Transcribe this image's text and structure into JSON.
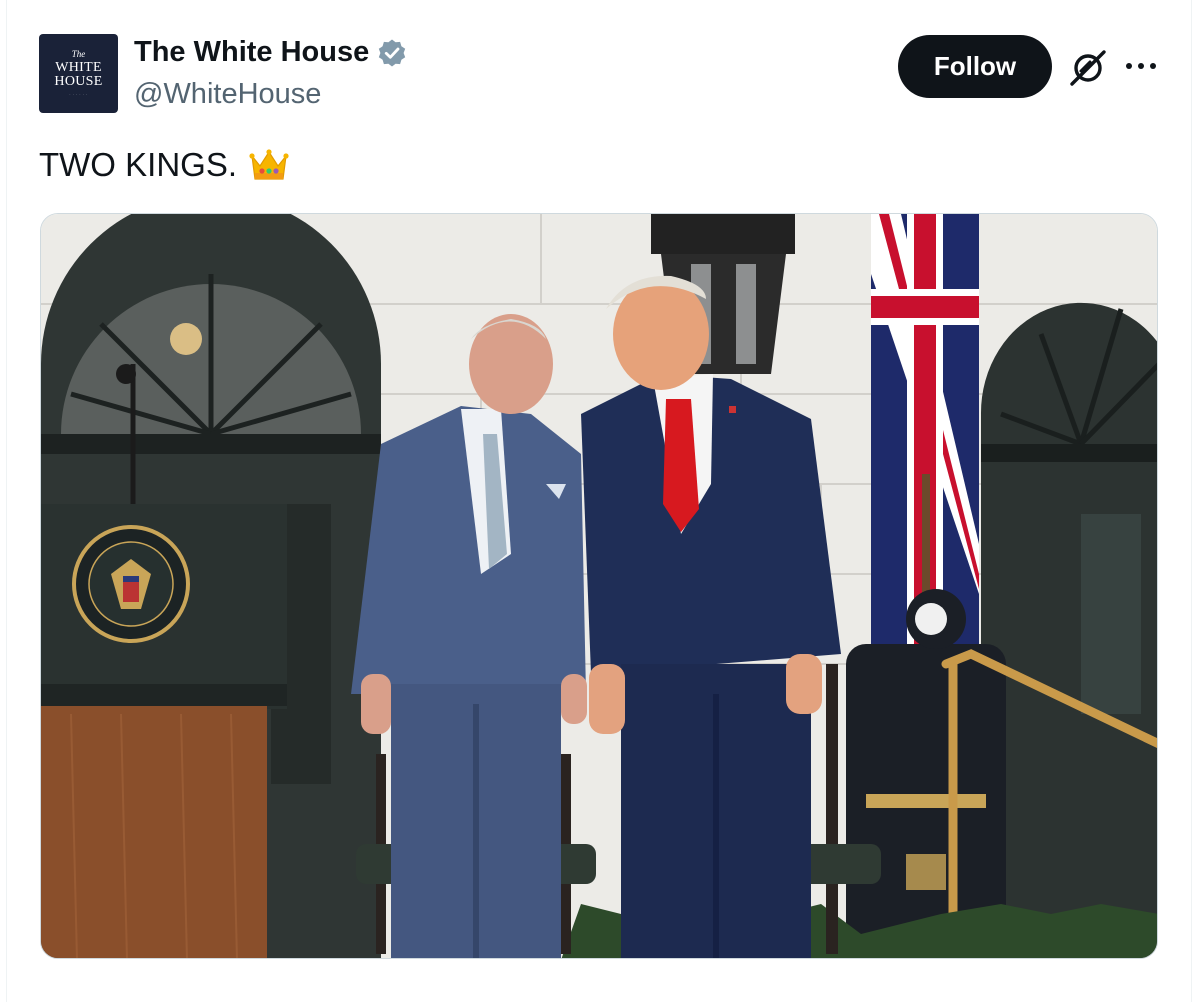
{
  "tweet": {
    "author": {
      "name": "The White House",
      "handle": "@WhiteHouse",
      "verified": true,
      "avatar_lines": [
        "The",
        "WHITE",
        "HOUSE"
      ]
    },
    "follow_label": "Follow",
    "text": "TWO KINGS.",
    "emoji": "crown-emoji",
    "media": {
      "type": "photo"
    }
  },
  "icons": {
    "verified": "verified-badge-icon",
    "grok": "grok-icon",
    "more": "more-icon"
  },
  "colors": {
    "text_primary": "#0f1419",
    "text_secondary": "#536471",
    "follow_bg": "#0f1419",
    "verified_badge": "#829aab"
  }
}
